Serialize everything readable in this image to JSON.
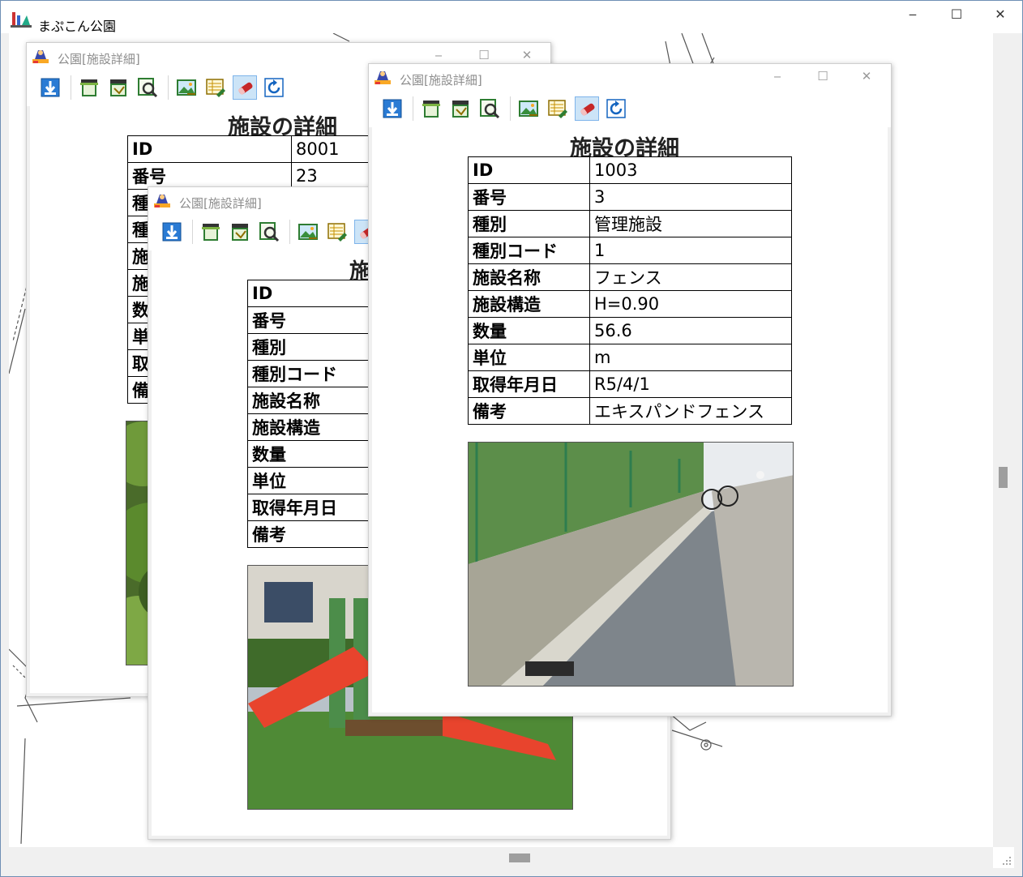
{
  "app": {
    "title": "まぷこん公園"
  },
  "window_controls": {
    "minimize": "‒",
    "maximize": "☐",
    "close": "✕"
  },
  "child_window": {
    "title": "公園[施設詳細]",
    "heading": "施設の詳細"
  },
  "labels": [
    "ID",
    "番号",
    "種別",
    "種別コード",
    "施設名称",
    "施設構造",
    "数量",
    "単位",
    "取得年月日",
    "備考"
  ],
  "toolbar_icons": [
    "download-icon",
    "print-icon",
    "print-preview-icon",
    "preview-icon",
    "photo-icon",
    "edit-sheet-icon",
    "eraser-icon",
    "refresh-icon"
  ],
  "window_a": {
    "id": "8001",
    "number": "23",
    "label_initials": [
      "種",
      "種",
      "施",
      "施",
      "数",
      "単",
      "取",
      "備"
    ]
  },
  "window_b": {
    "heading_part": "施"
  },
  "window_c": {
    "id": "1003",
    "number": "3",
    "type": "管理施設",
    "type_code": "1",
    "facility_name": "フェンス",
    "facility_structure": "H=0.90",
    "quantity": "56.6",
    "unit": "m",
    "acquired_date": "R5/4/1",
    "remarks": "エキスパンドフェンス"
  },
  "colors": {
    "accent": "#1e6fc0",
    "titlebar_inactive_text": "#8c8c8c",
    "slide_red": "#e8442d",
    "fence_green": "#2e7d4f"
  }
}
